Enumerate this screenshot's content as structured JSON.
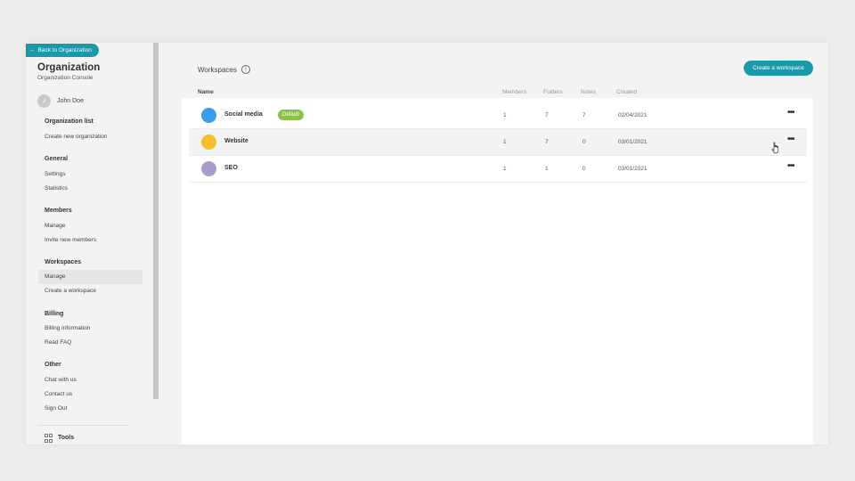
{
  "back_label": "Back to Organization",
  "org": {
    "title": "Organization",
    "subtitle": "Organization Console"
  },
  "user": {
    "initial": "J",
    "name": "John Doe"
  },
  "sidebar": {
    "sections": [
      {
        "title": "Organization list",
        "items": [
          "Create new organization"
        ]
      },
      {
        "title": "General",
        "items": [
          "Settings",
          "Statistics"
        ]
      },
      {
        "title": "Members",
        "items": [
          "Manage",
          "Invite new members"
        ]
      },
      {
        "title": "Workspaces",
        "items": [
          "Manage",
          "Create a workspace"
        ]
      },
      {
        "title": "Billing",
        "items": [
          "Billing information",
          "Read FAQ"
        ]
      },
      {
        "title": "Other",
        "items": [
          "Chat with us",
          "Contact us",
          "Sign Out"
        ]
      }
    ],
    "active_section": "Workspaces",
    "active_item": "Manage",
    "tools_label": "Tools"
  },
  "main": {
    "title": "Workspaces",
    "info_icon": "info-icon",
    "create_button": "Create a workspace",
    "columns": [
      "Name",
      "Members",
      "Folders",
      "Notes",
      "Created"
    ],
    "rows": [
      {
        "name": "Social media",
        "badge": "Default",
        "color": "#3d9be9",
        "members": "1",
        "folders": "7",
        "notes": "7",
        "created": "02/04/2021"
      },
      {
        "name": "Website",
        "badge": "",
        "color": "#f4c02e",
        "members": "1",
        "folders": "7",
        "notes": "0",
        "created": "03/01/2021"
      },
      {
        "name": "SEO",
        "badge": "",
        "color": "#a99ccb",
        "members": "1",
        "folders": "1",
        "notes": "0",
        "created": "03/01/2021"
      }
    ],
    "more_glyph": "•••"
  },
  "colors": {
    "accent": "#1a9aa8",
    "badge": "#8bc34a"
  }
}
